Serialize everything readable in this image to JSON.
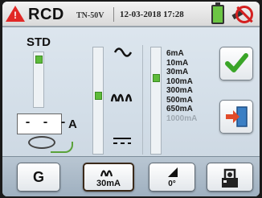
{
  "header": {
    "title": "RCD",
    "system": "TN-50V",
    "datetime": "12-03-2018 17:28"
  },
  "left_panel": {
    "mode_label": "STD",
    "value": "- - -",
    "unit": "A"
  },
  "current_options": [
    "6mA",
    "10mA",
    "30mA",
    "100mA",
    "300mA",
    "500mA",
    "650mA",
    "1000mA"
  ],
  "selected_current": "30mA",
  "toolbar": {
    "g_label": "G",
    "current_label": "30mA",
    "angle_label": "0°"
  },
  "colors": {
    "accent_green": "#5dbb3a",
    "warning_red": "#e12826"
  }
}
